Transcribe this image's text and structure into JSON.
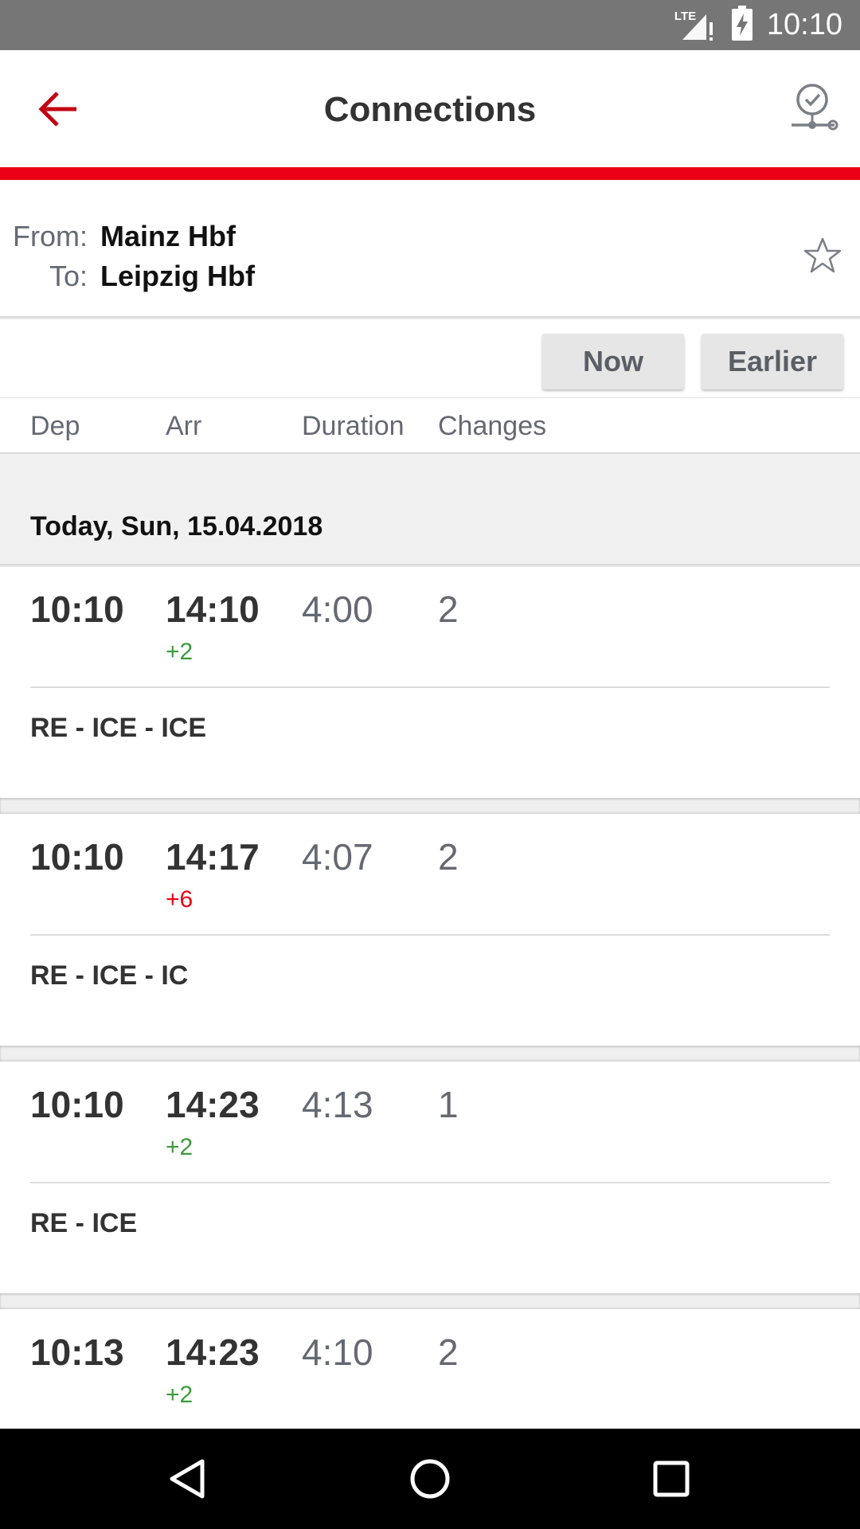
{
  "status_bar": {
    "network": "LTE",
    "time": "10:10"
  },
  "header": {
    "title": "Connections",
    "back_icon": "arrow-left-icon",
    "alarm_icon": "alarm-check-icon"
  },
  "route": {
    "from_label": "From:",
    "from_value": "Mainz Hbf",
    "to_label": "To:",
    "to_value": "Leipzig Hbf"
  },
  "buttons": {
    "now": "Now",
    "earlier": "Earlier"
  },
  "columns": {
    "dep": "Dep",
    "arr": "Arr",
    "duration": "Duration",
    "changes": "Changes"
  },
  "date_label": "Today, Sun, 15.04.2018",
  "connections": [
    {
      "dep": "10:10",
      "arr": "14:10",
      "delay": "+2",
      "delay_color": "#3c9b3c",
      "duration": "4:00",
      "changes": "2",
      "products": "RE - ICE - ICE"
    },
    {
      "dep": "10:10",
      "arr": "14:17",
      "delay": "+6",
      "delay_color": "#ec0016",
      "duration": "4:07",
      "changes": "2",
      "products": "RE - ICE - IC"
    },
    {
      "dep": "10:10",
      "arr": "14:23",
      "delay": "+2",
      "delay_color": "#3c9b3c",
      "duration": "4:13",
      "changes": "1",
      "products": "RE - ICE"
    },
    {
      "dep": "10:13",
      "arr": "14:23",
      "delay": "+2",
      "delay_color": "#3c9b3c",
      "duration": "4:10",
      "changes": "2",
      "products": ""
    }
  ],
  "colors": {
    "brand_red": "#ec0016",
    "delay_green": "#3c9b3c",
    "status_bar": "#767676"
  }
}
